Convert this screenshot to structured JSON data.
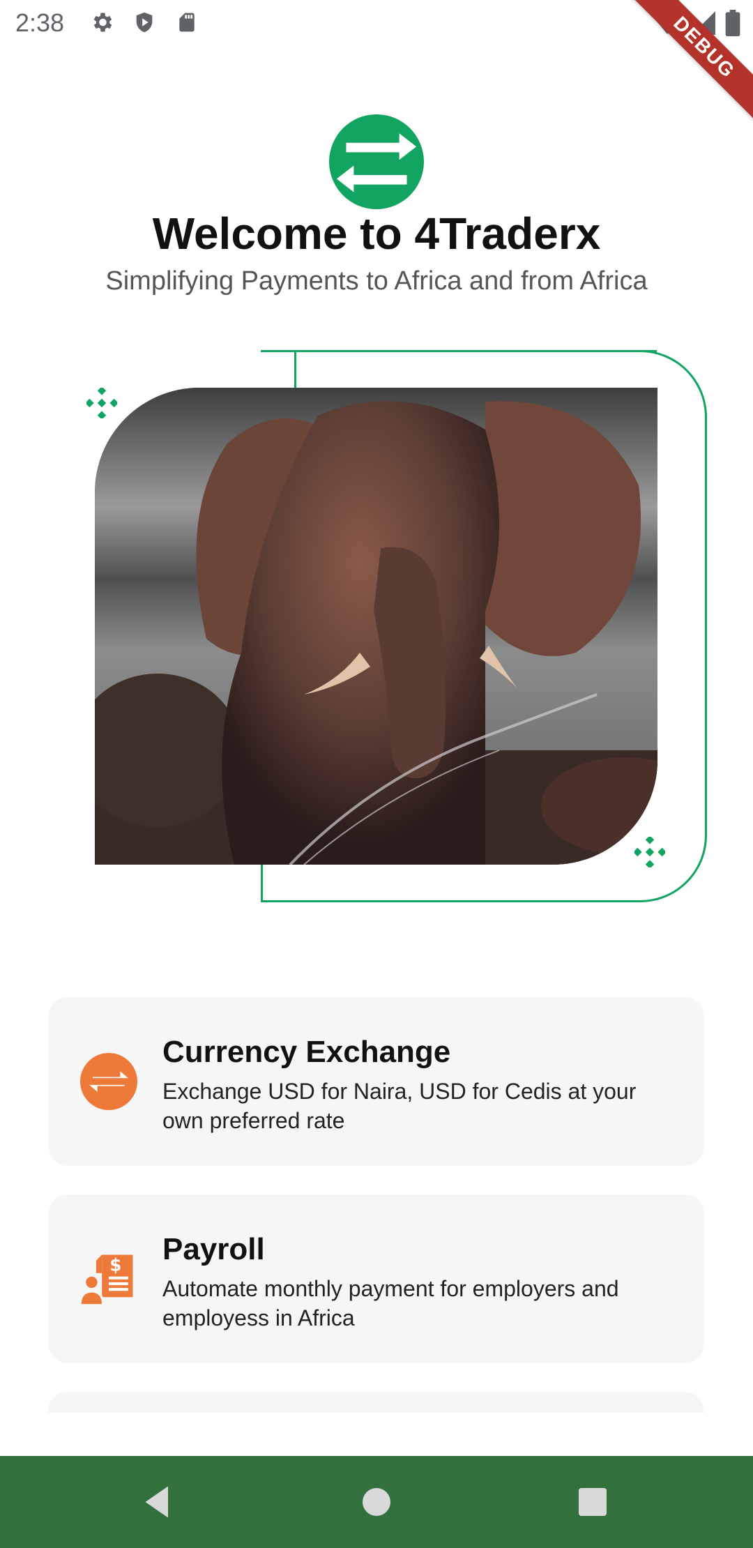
{
  "status_bar": {
    "time": "2:38",
    "left_icons": [
      "gear-icon",
      "shield-play-icon",
      "sd-card-icon"
    ],
    "right_icons": [
      "wifi-icon",
      "signal-icon",
      "battery-icon"
    ]
  },
  "debug_banner": {
    "label": "DEBUG"
  },
  "header": {
    "logo": "exchange-arrows-logo",
    "title": "Welcome to 4Traderx",
    "subtitle": "Simplifying Payments to Africa and from Africa"
  },
  "hero": {
    "image": "elephant-photo"
  },
  "cards": [
    {
      "icon": "exchange-icon",
      "title": "Currency Exchange",
      "description": "Exchange USD for Naira, USD for Cedis at your own preferred rate"
    },
    {
      "icon": "payroll-icon",
      "title": "Payroll",
      "description": "Automate monthly payment for employers and employess in Africa"
    }
  ],
  "colors": {
    "brand_green": "#12a461",
    "accent_orange": "#ee7a3a",
    "nav_bar": "#32703e",
    "card_bg": "#f6f6f6"
  },
  "nav_bar": {
    "buttons": [
      "back-icon",
      "home-icon",
      "recents-icon"
    ]
  }
}
